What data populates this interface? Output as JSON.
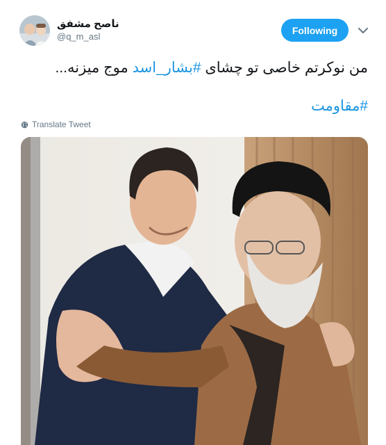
{
  "tweet": {
    "display_name": "ناصح مشفق",
    "handle": "@q_m_asl",
    "follow_label": "Following",
    "text_before": "من نوکرتم خاصی تو چشای ",
    "hashtag_inline": "#بشار_اسد",
    "text_after": " موج میزنه...",
    "hashtag_line": "#مقاومت",
    "translate_label": "Translate Tweet"
  },
  "colors": {
    "accent": "#1da1f2",
    "link": "#1b95e0",
    "muted": "#657786"
  },
  "icons": {
    "caret": "chevron-down-icon",
    "globe": "globe-icon"
  }
}
